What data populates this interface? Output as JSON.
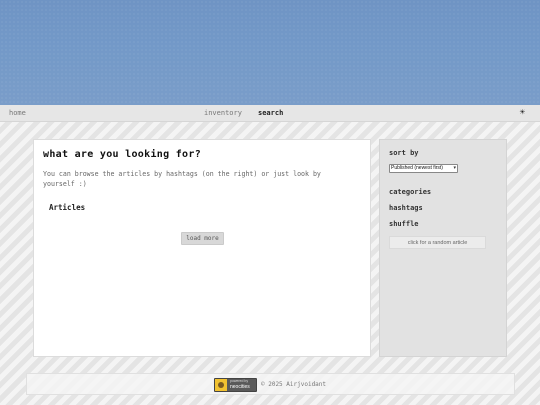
{
  "nav": {
    "home": "home",
    "inventory": "inventory",
    "search": "search",
    "theme_toggle_icon": "sun-icon",
    "theme_toggle_glyph": "☀"
  },
  "main": {
    "title": "what are you looking for?",
    "intro": "You can browse the articles by hashtags (on the right) or just look by yourself :)",
    "articles_heading": "Articles",
    "load_more_label": "load more"
  },
  "sidebar": {
    "sort_heading": "sort by",
    "sort_selected": "Published (newest first)",
    "categories_heading": "categories",
    "hashtags_heading": "hashtags",
    "shuffle_heading": "shuffle",
    "random_button_label": "click for a random article"
  },
  "footer": {
    "badge_top": "powered by",
    "badge_main": "neocities",
    "copyright": "© 2025 Airjvoidant"
  },
  "colors": {
    "banner": "#7399c8",
    "page_background": "#e9e9e9",
    "card_background": "#ffffff",
    "sidebar_background": "#e2e2e2"
  }
}
